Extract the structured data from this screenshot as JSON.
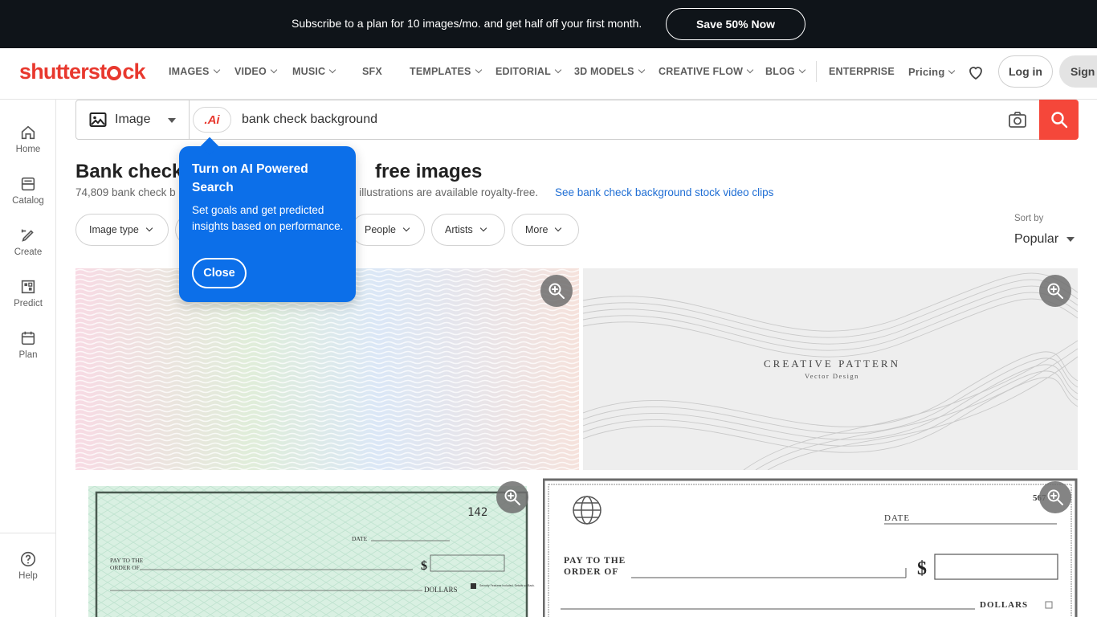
{
  "promo": {
    "text": "Subscribe to a plan for 10 images/mo. and get half off your first month.",
    "cta": "Save 50% Now"
  },
  "brand": {
    "part1": "shutterst",
    "part2": "ck",
    "color": "#e8382e"
  },
  "nav": {
    "items": [
      "IMAGES",
      "VIDEO",
      "MUSIC",
      "SFX",
      "TEMPLATES",
      "EDITORIAL",
      "3D MODELS",
      "CREATIVE FLOW",
      "BLOG",
      "ENTERPRISE",
      "Pricing"
    ],
    "login": "Log in",
    "signup": "Sign"
  },
  "sidebar": {
    "items": [
      {
        "label": "Home",
        "icon": "home-icon"
      },
      {
        "label": "Catalog",
        "icon": "catalog-icon"
      },
      {
        "label": "Create",
        "icon": "create-icon"
      },
      {
        "label": "Predict",
        "icon": "predict-icon"
      },
      {
        "label": "Plan",
        "icon": "plan-icon"
      }
    ],
    "help": "Help"
  },
  "search": {
    "type": "Image",
    "ai_label": ".Ai",
    "query": "bank check background"
  },
  "results": {
    "title_start": "Bank check",
    "title_end": "free images",
    "subtitle": "74,809 bank check b",
    "subtitle_tail": "d illustrations are available royalty-free.",
    "video_link": "See bank check background stock video clips"
  },
  "filters": [
    {
      "label": "Image type"
    },
    {
      "label": "People"
    },
    {
      "label": "Artists"
    },
    {
      "label": "More"
    }
  ],
  "sort": {
    "label": "Sort by",
    "value": "Popular"
  },
  "tooltip": {
    "title": "Turn on AI Powered Search",
    "body": "Set goals and get predicted insights based on performance.",
    "close": "Close"
  },
  "tiles": {
    "pattern_title": "CREATIVE PATTERN",
    "pattern_sub": "Vector Design",
    "check1": {
      "number": "142",
      "date": "DATE",
      "pay": "PAY TO THE",
      "order": "ORDER OF",
      "dollars": "DOLLARS",
      "security": "Security Features Included. Details on Back."
    },
    "check2": {
      "number": "567",
      "date": "DATE",
      "pay": "PAY TO THE",
      "order": "ORDER OF",
      "dollars": "DOLLARS"
    }
  },
  "colors": {
    "accent": "#f5473a",
    "tooltip": "#0c6fe9",
    "promo_bg": "#0f1419",
    "link": "#1f6ed4"
  }
}
